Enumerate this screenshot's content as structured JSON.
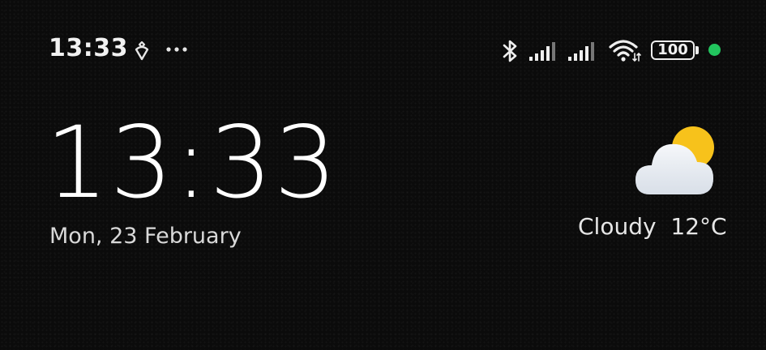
{
  "status_bar": {
    "time": "13:33",
    "icons": [
      "notification-icon",
      "more-dots-icon",
      "bluetooth-icon",
      "signal-icon",
      "signal-icon",
      "wifi-icon",
      "battery-icon"
    ],
    "battery_level": "100",
    "indicator_color": "#22c55e"
  },
  "lockscreen": {
    "clock": "13:33",
    "date": "Mon, 23 February"
  },
  "weather": {
    "icon": "partly-cloudy-icon",
    "condition": "Cloudy",
    "temperature": "12°C"
  }
}
